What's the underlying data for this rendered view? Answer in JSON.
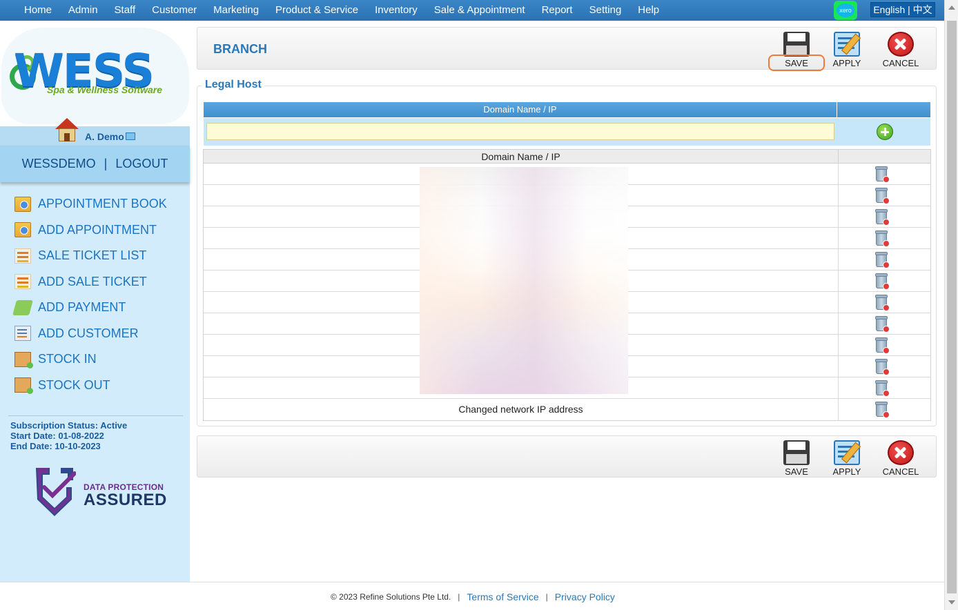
{
  "nav": {
    "items": [
      "Home",
      "Admin",
      "Staff",
      "Customer",
      "Marketing",
      "Product & Service",
      "Inventory",
      "Sale & Appointment",
      "Report",
      "Setting",
      "Help"
    ],
    "xero_label": "xero",
    "language": "English | 中文"
  },
  "sidebar": {
    "logo_text": "WESS",
    "logo_tagline": "Spa & Wellness Software",
    "user_name": "A. Demo",
    "account": "WESSDEMO",
    "separator": "|",
    "logout": "LOGOUT",
    "menu": [
      {
        "label": "APPOINTMENT BOOK",
        "icon": "appointment-book-icon"
      },
      {
        "label": "ADD APPOINTMENT",
        "icon": "add-appointment-icon"
      },
      {
        "label": "SALE TICKET LIST",
        "icon": "sale-ticket-list-icon"
      },
      {
        "label": "ADD SALE TICKET",
        "icon": "add-sale-ticket-icon"
      },
      {
        "label": "ADD PAYMENT",
        "icon": "payment-icon"
      },
      {
        "label": "ADD CUSTOMER",
        "icon": "add-customer-icon"
      },
      {
        "label": "STOCK IN",
        "icon": "stock-in-icon"
      },
      {
        "label": "STOCK OUT",
        "icon": "stock-out-icon"
      }
    ],
    "subscription_status": "Subscription Status: Active",
    "start_date": "Start Date: 01-08-2022",
    "end_date": "End Date: 10-10-2023",
    "badge_line1": "DATA PROTECTION",
    "badge_line2": "ASSURED"
  },
  "page": {
    "title": "BRANCH",
    "save": "SAVE",
    "apply": "APPLY",
    "cancel": "CANCEL"
  },
  "legal_host": {
    "section_title": "Legal Host",
    "header_column": "Domain Name / IP",
    "input_value": "",
    "list_header": "Domain Name / IP",
    "rows": [
      "",
      "",
      "",
      "",
      "",
      "",
      "",
      "",
      "",
      "",
      "",
      "Changed network IP address"
    ]
  },
  "footer": {
    "copyright": "© 2023 Refine Solutions Pte Ltd.",
    "separator": "|",
    "terms": "Terms of Service",
    "privacy": "Privacy Policy"
  }
}
